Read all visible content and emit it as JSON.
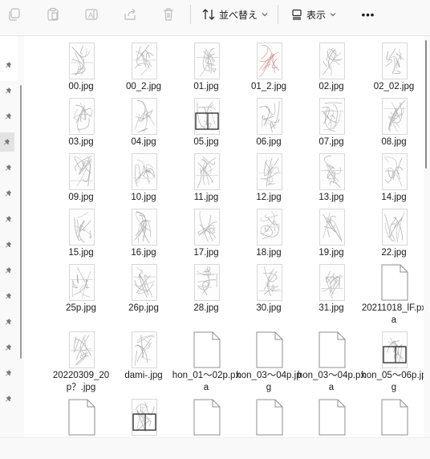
{
  "toolbar": {
    "sort_label": "並べ替え",
    "view_label": "表示",
    "more_label": "•••",
    "icons": [
      "copy-icon",
      "paste-icon",
      "rename-icon",
      "share-icon",
      "delete-icon",
      "sort-icon",
      "view-icon",
      "more-icon"
    ]
  },
  "files": [
    {
      "name": "00.jpg",
      "kind": "sketch"
    },
    {
      "name": "00_2.jpg",
      "kind": "sketch"
    },
    {
      "name": "01.jpg",
      "kind": "sketch"
    },
    {
      "name": "01_2.jpg",
      "kind": "color"
    },
    {
      "name": "02.jpg",
      "kind": "sketch"
    },
    {
      "name": "02_02.jpg",
      "kind": "sketch"
    },
    {
      "name": "03.jpg",
      "kind": "sketch"
    },
    {
      "name": "04.jpg",
      "kind": "sketch"
    },
    {
      "name": "05.jpg",
      "kind": "panels"
    },
    {
      "name": "06.jpg",
      "kind": "sketch"
    },
    {
      "name": "07.jpg",
      "kind": "sketch"
    },
    {
      "name": "08.jpg",
      "kind": "sketch"
    },
    {
      "name": "09.jpg",
      "kind": "sketch"
    },
    {
      "name": "10.jpg",
      "kind": "sketch"
    },
    {
      "name": "11.jpg",
      "kind": "sketch"
    },
    {
      "name": "12.jpg",
      "kind": "sketch"
    },
    {
      "name": "13.jpg",
      "kind": "sketch"
    },
    {
      "name": "14.jpg",
      "kind": "sketch"
    },
    {
      "name": "15.jpg",
      "kind": "sketch"
    },
    {
      "name": "16.jpg",
      "kind": "sketch"
    },
    {
      "name": "17.jpg",
      "kind": "sketch"
    },
    {
      "name": "18.jpg",
      "kind": "sketch"
    },
    {
      "name": "19.jpg",
      "kind": "sketch"
    },
    {
      "name": "22.jpg",
      "kind": "sketch"
    },
    {
      "name": "25p.jpg",
      "kind": "sketch"
    },
    {
      "name": "26p.jpg",
      "kind": "sketch"
    },
    {
      "name": "28.jpg",
      "kind": "sketch"
    },
    {
      "name": "30.jpg",
      "kind": "sketch"
    },
    {
      "name": "31.jpg",
      "kind": "sketch"
    },
    {
      "name": "20211018_lF.pxa",
      "kind": "file"
    },
    {
      "name": "20220309_20p？.jpg",
      "kind": "sketch"
    },
    {
      "name": "dami-.jpg",
      "kind": "sketch"
    },
    {
      "name": "hon_01～02p.pxa",
      "kind": "file"
    },
    {
      "name": "hon_03～04p.jpg",
      "kind": "file"
    },
    {
      "name": "hon_03～04p.pxa",
      "kind": "file"
    },
    {
      "name": "hon_05～06p.jpg",
      "kind": "panels"
    },
    {
      "name": "",
      "kind": "file"
    },
    {
      "name": "",
      "kind": "panels"
    },
    {
      "name": "",
      "kind": "file"
    },
    {
      "name": "",
      "kind": "file"
    },
    {
      "name": "",
      "kind": "file"
    },
    {
      "name": "",
      "kind": "file"
    }
  ]
}
